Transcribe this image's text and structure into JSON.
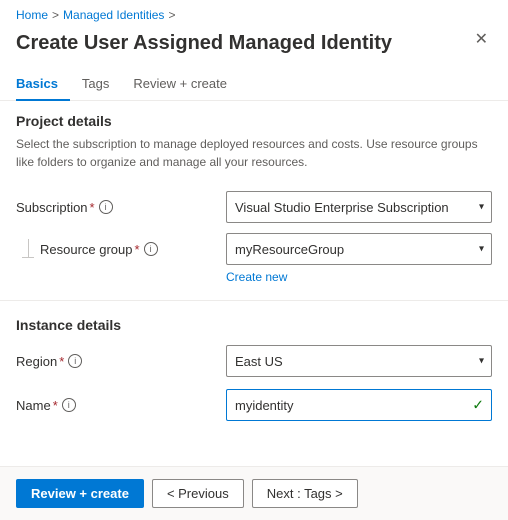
{
  "breadcrumb": {
    "home": "Home",
    "separator1": ">",
    "managed_identities": "Managed Identities",
    "separator2": ">"
  },
  "page": {
    "title": "Create User Assigned Managed Identity"
  },
  "tabs": [
    {
      "id": "basics",
      "label": "Basics",
      "active": true
    },
    {
      "id": "tags",
      "label": "Tags",
      "active": false
    },
    {
      "id": "review_create",
      "label": "Review + create",
      "active": false
    }
  ],
  "project_details": {
    "title": "Project details",
    "description": "Select the subscription to manage deployed resources and costs. Use resource groups like folders to organize and manage all your resources."
  },
  "subscription": {
    "label": "Subscription",
    "value": "Visual Studio Enterprise Subscription"
  },
  "resource_group": {
    "label": "Resource group",
    "value": "myResourceGroup",
    "create_new": "Create new"
  },
  "instance_details": {
    "title": "Instance details"
  },
  "region": {
    "label": "Region",
    "value": "East US"
  },
  "name": {
    "label": "Name",
    "value": "myidentity"
  },
  "footer": {
    "review_create": "Review + create",
    "previous": "< Previous",
    "next": "Next : Tags >"
  },
  "icons": {
    "close": "✕",
    "chevron": "▾",
    "info": "i",
    "check": "✓"
  }
}
